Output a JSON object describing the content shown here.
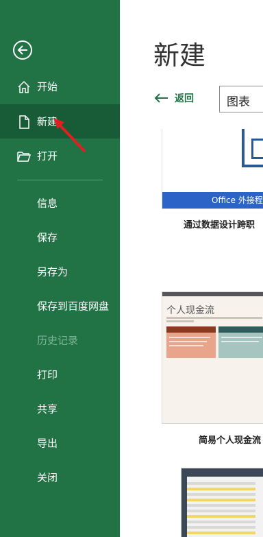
{
  "sidebar": {
    "back_icon": "back-circle-arrow-icon",
    "items": [
      {
        "label": "开始",
        "icon": "home-icon"
      },
      {
        "label": "新建",
        "icon": "new-document-icon"
      },
      {
        "label": "打开",
        "icon": "open-folder-icon"
      },
      {
        "label": "信息"
      },
      {
        "label": "保存"
      },
      {
        "label": "另存为"
      },
      {
        "label": "保存到百度网盘"
      },
      {
        "label": "历史记录"
      },
      {
        "label": "打印"
      },
      {
        "label": "共享"
      },
      {
        "label": "导出"
      },
      {
        "label": "关闭"
      }
    ]
  },
  "main": {
    "title": "新建",
    "back_label": "返回",
    "search_value": "图表",
    "templates": [
      {
        "caption": "通过数据设计跨职",
        "banner": "Office 外接程序"
      },
      {
        "caption": "简易个人现金流",
        "thumb_title": "个人现金流"
      },
      {
        "caption": ""
      }
    ]
  },
  "colors": {
    "sidebar": "#217346",
    "sidebar_active": "#185c37",
    "accent": "#217346",
    "annotation": "#e02020"
  }
}
